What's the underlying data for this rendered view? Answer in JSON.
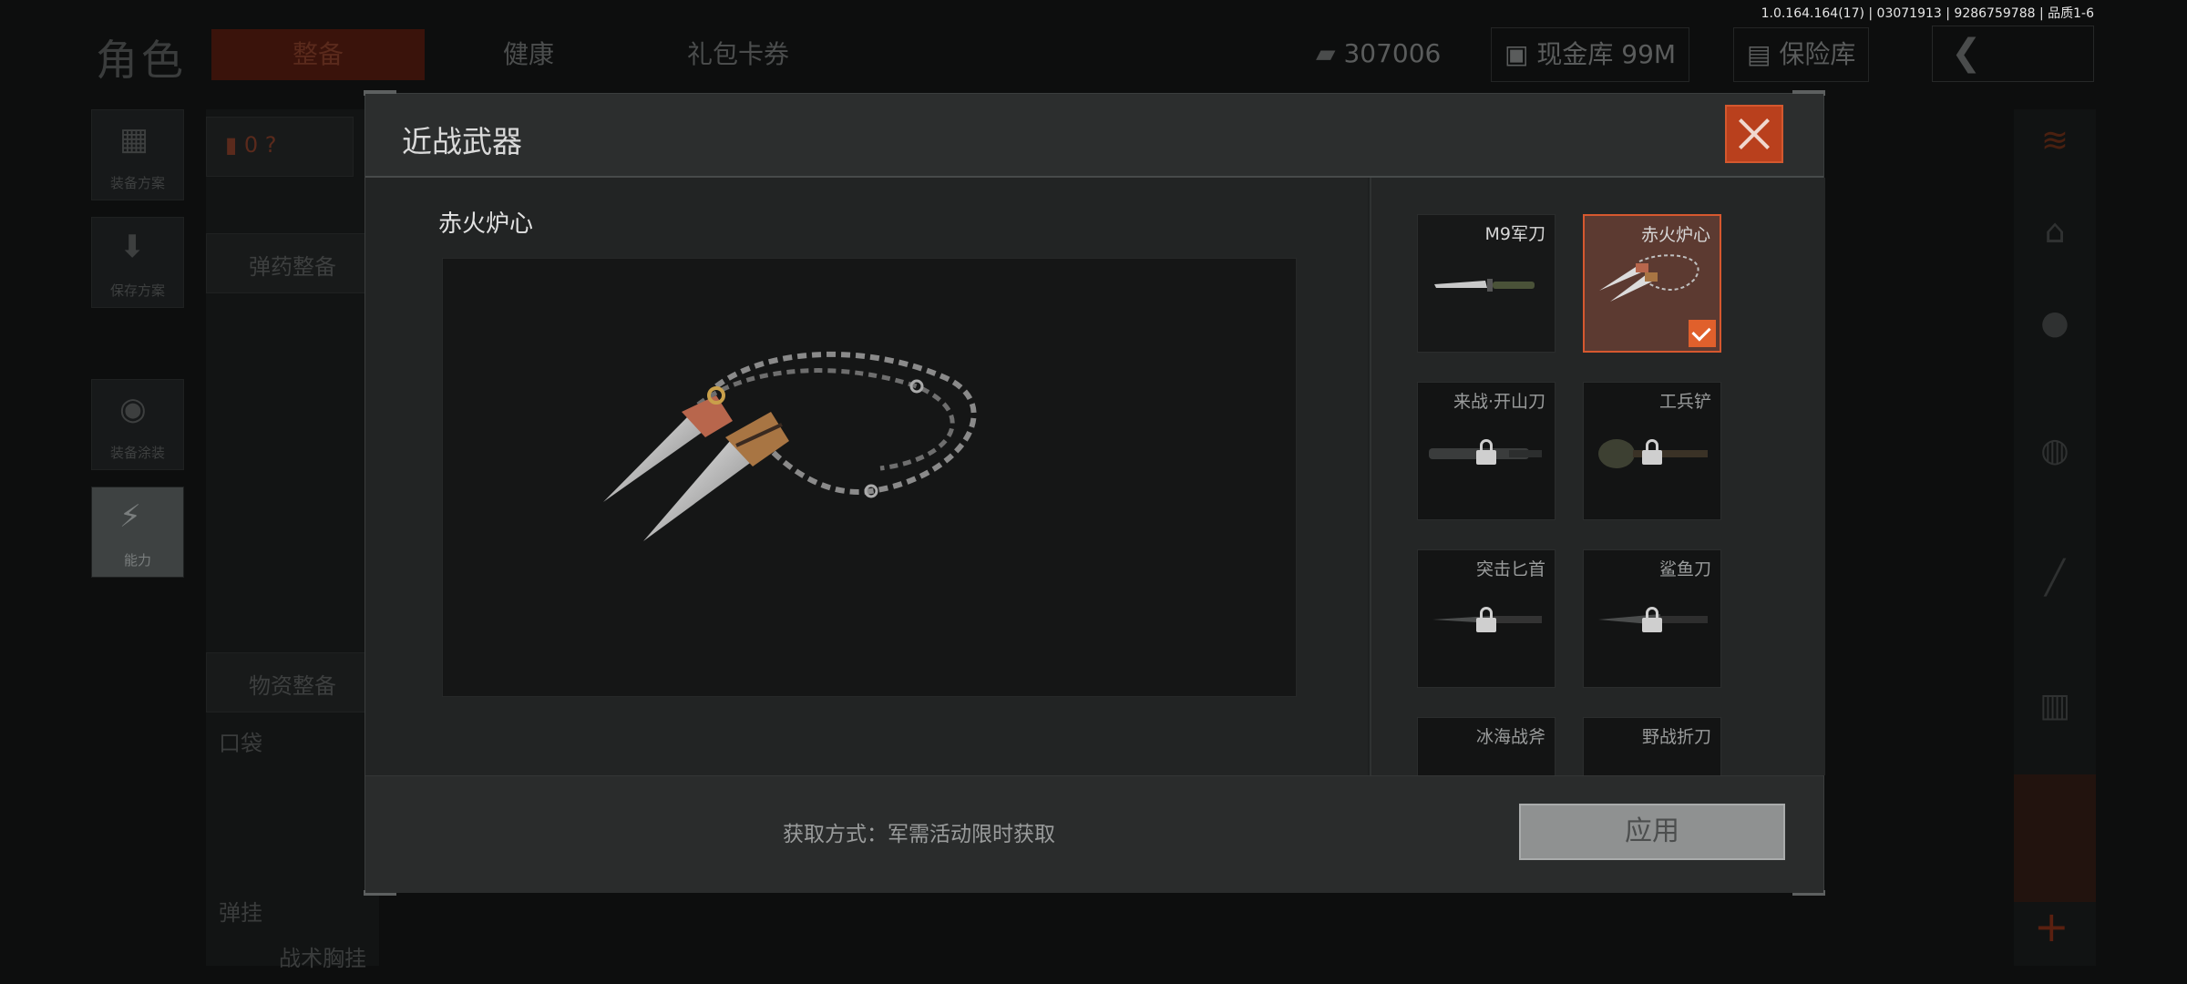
{
  "version_info": "1.0.164.164(17) | 03071913 | 9286759788 | 品质1-6",
  "background": {
    "page_title": "角色",
    "tabs": [
      {
        "label": "整备",
        "active": true
      },
      {
        "label": "健康",
        "active": false
      },
      {
        "label": "礼包卡券",
        "active": false
      }
    ],
    "currency_value": "307006",
    "cash_vault_label": "现金库 99M",
    "safe_label": "保险库",
    "left_rail": [
      {
        "label": "装备方案"
      },
      {
        "label": "保存方案"
      },
      {
        "label": "装备涂装"
      },
      {
        "label": "能力"
      }
    ],
    "left_panel": {
      "ammo_prep": "弹药整备",
      "supply_prep": "物资整备",
      "pocket": "口袋",
      "chest_rig": "弹挂",
      "chest_rig_item": "战术胸挂"
    }
  },
  "modal": {
    "title": "近战武器",
    "selected_item_name": "赤火炉心",
    "items": [
      {
        "name": "M9军刀",
        "state": "unlocked",
        "selected": false
      },
      {
        "name": "赤火炉心",
        "state": "unlocked",
        "selected": true
      },
      {
        "name": "来战·开山刀",
        "state": "locked",
        "selected": false
      },
      {
        "name": "工兵铲",
        "state": "locked",
        "selected": false
      },
      {
        "name": "突击匕首",
        "state": "locked",
        "selected": false
      },
      {
        "name": "鲨鱼刀",
        "state": "locked",
        "selected": false
      },
      {
        "name": "冰海战斧",
        "state": "locked",
        "selected": false
      },
      {
        "name": "野战折刀",
        "state": "locked",
        "selected": false
      }
    ],
    "acquire_method": "获取方式：军需活动限时获取",
    "apply_label": "应用"
  },
  "colors": {
    "accent": "#d6582f",
    "modal_bg": "#1e2020",
    "apply_button": "#8f9191"
  }
}
